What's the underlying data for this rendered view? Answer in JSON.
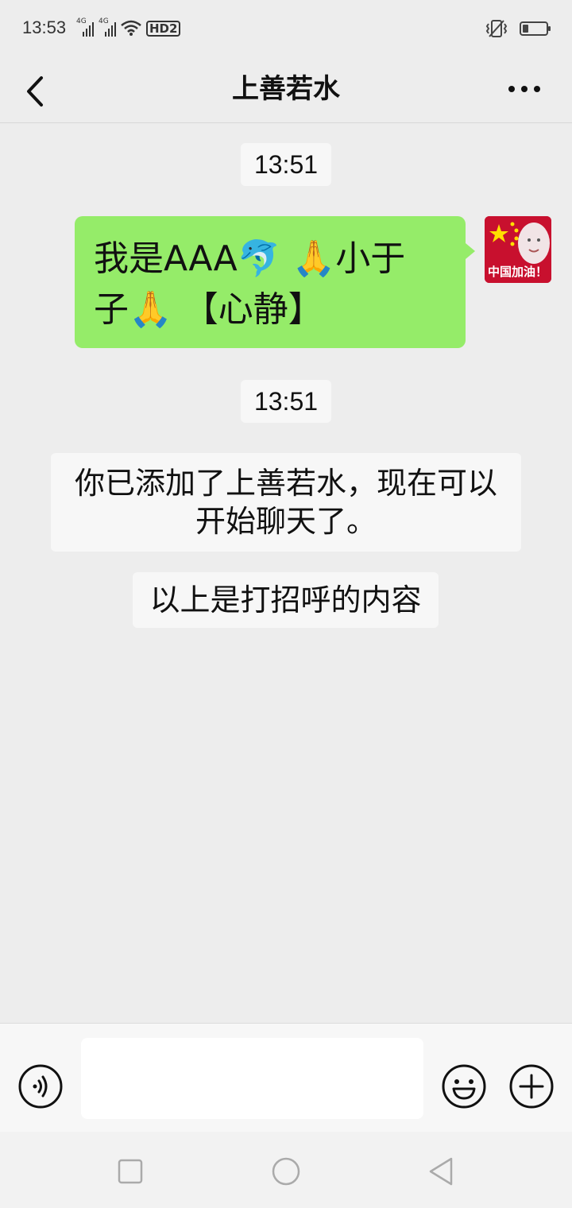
{
  "status_bar": {
    "time": "13:53",
    "sim1": "4G",
    "sim2": "4G",
    "hd": "HD2",
    "icons": [
      "signal-icon",
      "signal-icon",
      "wifi-icon",
      "hd-icon",
      "vibrate-icon",
      "battery-icon"
    ]
  },
  "header": {
    "back_icon": "chevron-left-icon",
    "title": "上善若水",
    "more_icon": "more-dots-icon"
  },
  "messages": {
    "timestamp_1": "13:51",
    "sent_line_1": "我是AAA🐬 🙏小于",
    "sent_line_2": "子🙏 【心静】",
    "avatar_text": "中国加油！",
    "timestamp_2": "13:51",
    "system_notice_line_1": "你已添加了上善若水，现在可以",
    "system_notice_line_2": "开始聊天了。",
    "greeting_notice": "以上是打招呼的内容"
  },
  "input_bar": {
    "value": "",
    "placeholder": "",
    "voice_icon": "voice-icon",
    "emoji_icon": "emoji-icon",
    "plus_icon": "plus-icon"
  },
  "system_nav": {
    "icons": [
      "recent-apps-icon",
      "home-icon",
      "back-triangle-icon"
    ]
  },
  "colors": {
    "background": "#ededed",
    "sent_bubble": "#95ec69",
    "notice_bg": "#f7f7f7",
    "flag_red": "#c8102e",
    "star_yellow": "#ffde00"
  }
}
